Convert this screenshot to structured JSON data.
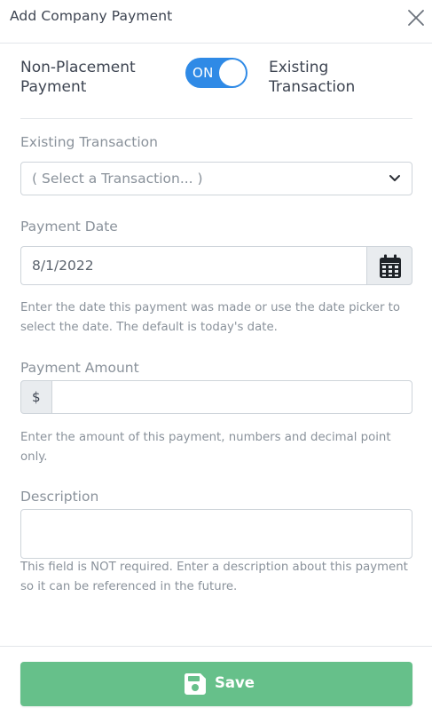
{
  "header": {
    "title": "Add Company Payment",
    "close_icon": "close-icon"
  },
  "toggle": {
    "left_label": "Non-Placement Payment",
    "state_text": "ON",
    "right_label": "Existing Transaction",
    "is_on": true,
    "color": "#2f8ae6"
  },
  "existing_transaction": {
    "label": "Existing Transaction",
    "selected": "( Select a Transaction... )"
  },
  "payment_date": {
    "label": "Payment Date",
    "value": "8/1/2022",
    "help": "Enter the date this payment was made or use the date picker to select the date. The default is today's date.",
    "icon": "calendar-icon"
  },
  "payment_amount": {
    "label": "Payment Amount",
    "currency_symbol": "$",
    "value": "",
    "help": "Enter the amount of this payment, numbers and decimal point only."
  },
  "description": {
    "label": "Description",
    "value": "",
    "help": "This field is NOT required. Enter a description about this payment so it can be referenced in the future."
  },
  "footer": {
    "save_label": "Save",
    "save_icon": "save-icon",
    "save_color": "#66c08a"
  }
}
